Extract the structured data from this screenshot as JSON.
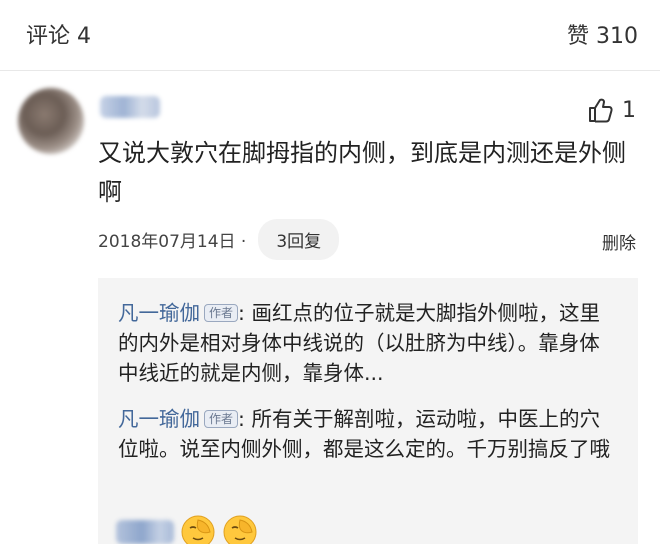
{
  "header": {
    "comments_label": "评论 4",
    "likes_label": "赞 310"
  },
  "comment": {
    "like_count": "1",
    "text": "又说大敦穴在脚拇指的内侧，到底是内测还是外侧啊",
    "date": "2018年07月14日 ·",
    "reply_count_label": "3回复",
    "delete_label": "删除"
  },
  "replies": [
    {
      "author": "凡一瑜伽",
      "badge": "作者",
      "separator": ":",
      "text": "画红点的位子就是大脚指外侧啦，这里的内外是相对身体中线说的（以肚脐为中线）。靠身体中线近的就是内侧，靠身体..."
    },
    {
      "author": "凡一瑜伽",
      "badge": "作者",
      "separator": ":",
      "text": "所有关于解剖啦，运动啦，中医上的穴位啦。说至内侧外侧，都是这么定的。千万别搞反了哦"
    }
  ],
  "icons": {
    "like": "thumbs-up-icon",
    "reaction": "facepalm-emoji-icon"
  },
  "colors": {
    "author_link": "#43689a",
    "reply_background": "#f4f4f4",
    "divider": "#e8e8e8"
  }
}
